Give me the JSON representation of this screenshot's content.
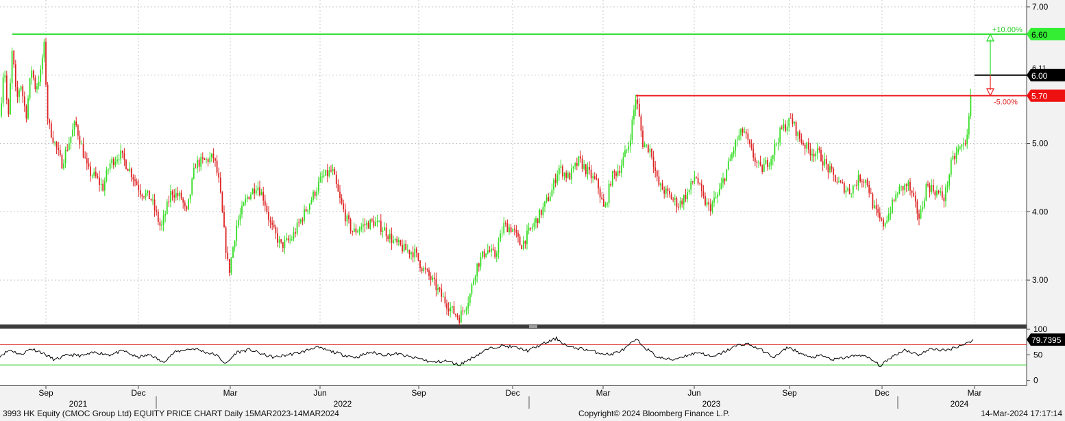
{
  "chart_data": {
    "type": "candlestick",
    "price_axis": {
      "ticks": [
        3.0,
        4.0,
        5.0,
        6.0,
        7.0
      ],
      "tick_labels": [
        "3.00",
        "4.00",
        "5.00",
        "6.00",
        "7.00"
      ],
      "range": [
        2.35,
        7.1
      ]
    },
    "rsi_axis": {
      "ticks": [
        0,
        50,
        100
      ],
      "tick_labels": [
        "0",
        "50",
        "100"
      ],
      "range": [
        -10,
        100
      ],
      "upper_band": 70,
      "lower_band": 30
    },
    "x_months": [
      "Sep",
      "Dec",
      "Mar",
      "Jun",
      "Sep",
      "Dec",
      "Mar",
      "Jun",
      "Sep",
      "Dec",
      "Mar"
    ],
    "x_years": [
      "2021",
      "2022",
      "2023",
      "2024"
    ],
    "colors": {
      "up": "#33dd22",
      "down": "#dd2222",
      "background": "#f2f2f2",
      "plot": "#ffffff",
      "target_line": "#22dd22",
      "stop_line": "#ee2222",
      "last_line": "#000000"
    },
    "levels": {
      "target": {
        "value": 6.6,
        "label": "6.60",
        "pct_label": "+10.00%"
      },
      "stop": {
        "value": 5.7,
        "label": "5.70",
        "pct_label": "-5.00%"
      },
      "last": {
        "value": 6.0,
        "label": "6.00"
      },
      "prev_close": {
        "value": 6.11,
        "label": "6.11"
      }
    },
    "price_path": [
      [
        0,
        5.4
      ],
      [
        6,
        6.2
      ],
      [
        12,
        5.3
      ],
      [
        18,
        6.4
      ],
      [
        24,
        5.6
      ],
      [
        30,
        5.9
      ],
      [
        38,
        5.4
      ],
      [
        46,
        6.1
      ],
      [
        52,
        5.8
      ],
      [
        60,
        6.05
      ],
      [
        64,
        6.5
      ],
      [
        70,
        5.3
      ],
      [
        80,
        5.0
      ],
      [
        90,
        4.7
      ],
      [
        100,
        5.0
      ],
      [
        110,
        5.3
      ],
      [
        118,
        5.0
      ],
      [
        128,
        4.6
      ],
      [
        140,
        4.5
      ],
      [
        150,
        4.35
      ],
      [
        160,
        4.7
      ],
      [
        175,
        4.85
      ],
      [
        190,
        4.6
      ],
      [
        205,
        4.3
      ],
      [
        220,
        4.2
      ],
      [
        235,
        3.75
      ],
      [
        250,
        4.3
      ],
      [
        265,
        4.2
      ],
      [
        272,
        3.95
      ],
      [
        285,
        4.7
      ],
      [
        300,
        4.75
      ],
      [
        312,
        4.8
      ],
      [
        320,
        4.4
      ],
      [
        328,
        3.6
      ],
      [
        334,
        3.1
      ],
      [
        345,
        3.8
      ],
      [
        360,
        4.2
      ],
      [
        375,
        4.4
      ],
      [
        385,
        4.2
      ],
      [
        395,
        3.8
      ],
      [
        410,
        3.5
      ],
      [
        425,
        3.6
      ],
      [
        440,
        3.9
      ],
      [
        455,
        4.2
      ],
      [
        470,
        4.5
      ],
      [
        485,
        4.6
      ],
      [
        495,
        4.2
      ],
      [
        505,
        3.9
      ],
      [
        515,
        3.7
      ],
      [
        530,
        3.8
      ],
      [
        545,
        3.85
      ],
      [
        560,
        3.75
      ],
      [
        575,
        3.55
      ],
      [
        590,
        3.45
      ],
      [
        605,
        3.4
      ],
      [
        615,
        3.2
      ],
      [
        630,
        3.0
      ],
      [
        645,
        2.75
      ],
      [
        660,
        2.55
      ],
      [
        670,
        2.45
      ],
      [
        685,
        2.75
      ],
      [
        695,
        3.2
      ],
      [
        710,
        3.45
      ],
      [
        722,
        3.35
      ],
      [
        735,
        3.8
      ],
      [
        748,
        3.75
      ],
      [
        760,
        3.5
      ],
      [
        775,
        3.75
      ],
      [
        790,
        4.0
      ],
      [
        805,
        4.3
      ],
      [
        815,
        4.65
      ],
      [
        830,
        4.5
      ],
      [
        845,
        4.75
      ],
      [
        860,
        4.55
      ],
      [
        872,
        4.4
      ],
      [
        882,
        4.0
      ],
      [
        892,
        4.5
      ],
      [
        905,
        4.65
      ],
      [
        918,
        5.0
      ],
      [
        928,
        5.7
      ],
      [
        938,
        5.0
      ],
      [
        950,
        4.9
      ],
      [
        960,
        4.4
      ],
      [
        975,
        4.25
      ],
      [
        990,
        4.1
      ],
      [
        1005,
        4.3
      ],
      [
        1015,
        4.55
      ],
      [
        1025,
        4.2
      ],
      [
        1035,
        4.05
      ],
      [
        1048,
        4.25
      ],
      [
        1060,
        4.6
      ],
      [
        1075,
        5.05
      ],
      [
        1085,
        5.2
      ],
      [
        1095,
        4.9
      ],
      [
        1110,
        4.6
      ],
      [
        1125,
        4.8
      ],
      [
        1140,
        5.2
      ],
      [
        1155,
        5.35
      ],
      [
        1165,
        5.1
      ],
      [
        1180,
        4.9
      ],
      [
        1195,
        4.85
      ],
      [
        1210,
        4.6
      ],
      [
        1225,
        4.4
      ],
      [
        1240,
        4.3
      ],
      [
        1255,
        4.5
      ],
      [
        1265,
        4.45
      ],
      [
        1275,
        4.05
      ],
      [
        1288,
        3.8
      ],
      [
        1298,
        4.0
      ],
      [
        1310,
        4.3
      ],
      [
        1325,
        4.4
      ],
      [
        1335,
        4.1
      ],
      [
        1342,
        3.9
      ],
      [
        1352,
        4.4
      ],
      [
        1365,
        4.3
      ],
      [
        1378,
        4.2
      ],
      [
        1388,
        4.7
      ],
      [
        1398,
        4.9
      ],
      [
        1408,
        5.0
      ],
      [
        1415,
        5.4
      ],
      [
        1420,
        6.3
      ]
    ],
    "rsi_path": [
      [
        0,
        48
      ],
      [
        15,
        60
      ],
      [
        30,
        50
      ],
      [
        45,
        62
      ],
      [
        60,
        55
      ],
      [
        80,
        40
      ],
      [
        100,
        50
      ],
      [
        120,
        48
      ],
      [
        140,
        55
      ],
      [
        160,
        50
      ],
      [
        180,
        58
      ],
      [
        200,
        45
      ],
      [
        220,
        50
      ],
      [
        237,
        35
      ],
      [
        255,
        55
      ],
      [
        270,
        60
      ],
      [
        285,
        62
      ],
      [
        300,
        55
      ],
      [
        315,
        50
      ],
      [
        330,
        32
      ],
      [
        345,
        55
      ],
      [
        365,
        60
      ],
      [
        385,
        50
      ],
      [
        400,
        45
      ],
      [
        420,
        50
      ],
      [
        440,
        55
      ],
      [
        460,
        65
      ],
      [
        480,
        58
      ],
      [
        500,
        50
      ],
      [
        520,
        45
      ],
      [
        540,
        55
      ],
      [
        560,
        50
      ],
      [
        580,
        52
      ],
      [
        600,
        45
      ],
      [
        615,
        42
      ],
      [
        630,
        35
      ],
      [
        650,
        38
      ],
      [
        670,
        30
      ],
      [
        690,
        45
      ],
      [
        710,
        60
      ],
      [
        730,
        68
      ],
      [
        750,
        65
      ],
      [
        770,
        58
      ],
      [
        790,
        70
      ],
      [
        812,
        82
      ],
      [
        830,
        65
      ],
      [
        850,
        62
      ],
      [
        870,
        55
      ],
      [
        890,
        50
      ],
      [
        910,
        60
      ],
      [
        928,
        80
      ],
      [
        945,
        60
      ],
      [
        960,
        45
      ],
      [
        980,
        40
      ],
      [
        1000,
        48
      ],
      [
        1020,
        55
      ],
      [
        1040,
        45
      ],
      [
        1060,
        58
      ],
      [
        1075,
        68
      ],
      [
        1090,
        72
      ],
      [
        1110,
        60
      ],
      [
        1130,
        45
      ],
      [
        1150,
        65
      ],
      [
        1165,
        55
      ],
      [
        1180,
        45
      ],
      [
        1200,
        48
      ],
      [
        1215,
        40
      ],
      [
        1235,
        45
      ],
      [
        1255,
        50
      ],
      [
        1270,
        42
      ],
      [
        1285,
        28
      ],
      [
        1300,
        45
      ],
      [
        1320,
        60
      ],
      [
        1340,
        50
      ],
      [
        1360,
        62
      ],
      [
        1380,
        58
      ],
      [
        1400,
        68
      ],
      [
        1410,
        72
      ],
      [
        1420,
        79.7
      ]
    ],
    "rsi_last": {
      "value": 79.7395,
      "label": "79.7395"
    }
  },
  "footer": {
    "left": "3993 HK Equity (CMOC Group Ltd) EQUITY PRICE CHART  Daily 15MAR2023-14MAR2024",
    "middle": "Copyright© 2024 Bloomberg Finance L.P.",
    "right": "14-Mar-2024 17:17:14"
  }
}
